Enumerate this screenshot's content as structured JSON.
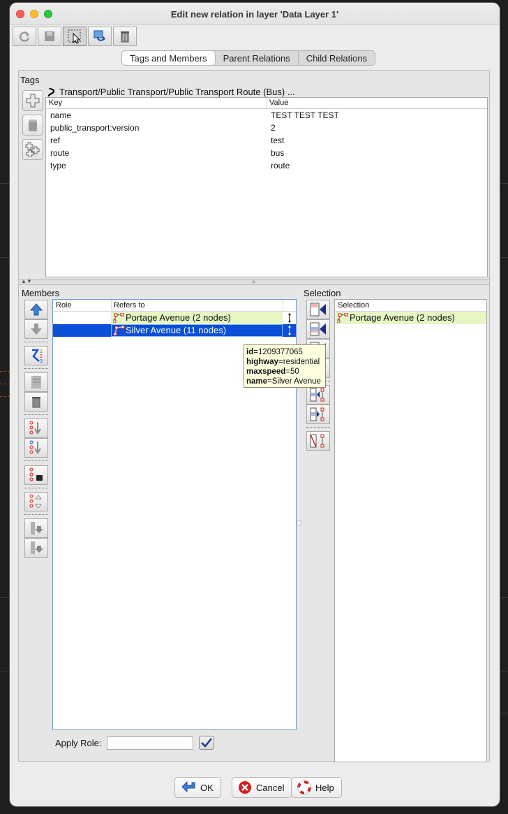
{
  "window": {
    "title": "Edit new relation in layer 'Data Layer 1'"
  },
  "toolbar": {
    "icons": [
      "refresh-icon",
      "save-icon",
      "select-icon",
      "zoom-icon",
      "delete-icon"
    ]
  },
  "tabs": [
    {
      "label": "Tags and Members",
      "active": true
    },
    {
      "label": "Parent Relations",
      "active": false
    },
    {
      "label": "Child Relations",
      "active": false
    }
  ],
  "tags": {
    "section_label": "Tags",
    "preset": "Transport/Public Transport/Public Transport Route (Bus) ...",
    "columns": {
      "key": "Key",
      "value": "Value"
    },
    "rows": [
      {
        "key": "name",
        "value": "TEST TEST TEST"
      },
      {
        "key": "public_transport:version",
        "value": "2"
      },
      {
        "key": "ref",
        "value": "test"
      },
      {
        "key": "route",
        "value": "bus"
      },
      {
        "key": "type",
        "value": "route"
      }
    ]
  },
  "members": {
    "section_label": "Members",
    "columns": {
      "role": "Role",
      "refers_to": "Refers to"
    },
    "rows": [
      {
        "role": "",
        "refers_to": "Portage Avenue (2 nodes)",
        "state": "highlighted"
      },
      {
        "role": "",
        "refers_to": "Silver Avenue (11 nodes)",
        "state": "selected"
      }
    ],
    "apply_role_label": "Apply Role:",
    "apply_role_value": ""
  },
  "selection": {
    "section_label": "Selection",
    "column": "Selection",
    "rows": [
      "Portage Avenue (2 nodes)"
    ]
  },
  "tooltip": {
    "lines": [
      {
        "key": "id",
        "value": "1209377065"
      },
      {
        "key": "highway",
        "value": "residential"
      },
      {
        "key": "maxspeed",
        "value": "50"
      },
      {
        "key": "name",
        "value": "Silver Avenue"
      }
    ]
  },
  "buttons": {
    "ok": "OK",
    "cancel": "Cancel",
    "help": "Help"
  },
  "colors": {
    "selected_row": "#0a4fd6",
    "highlight_row": "#e6f7c4",
    "tooltip_bg": "#ffffe0",
    "accent_blue": "#3f7fd1"
  }
}
